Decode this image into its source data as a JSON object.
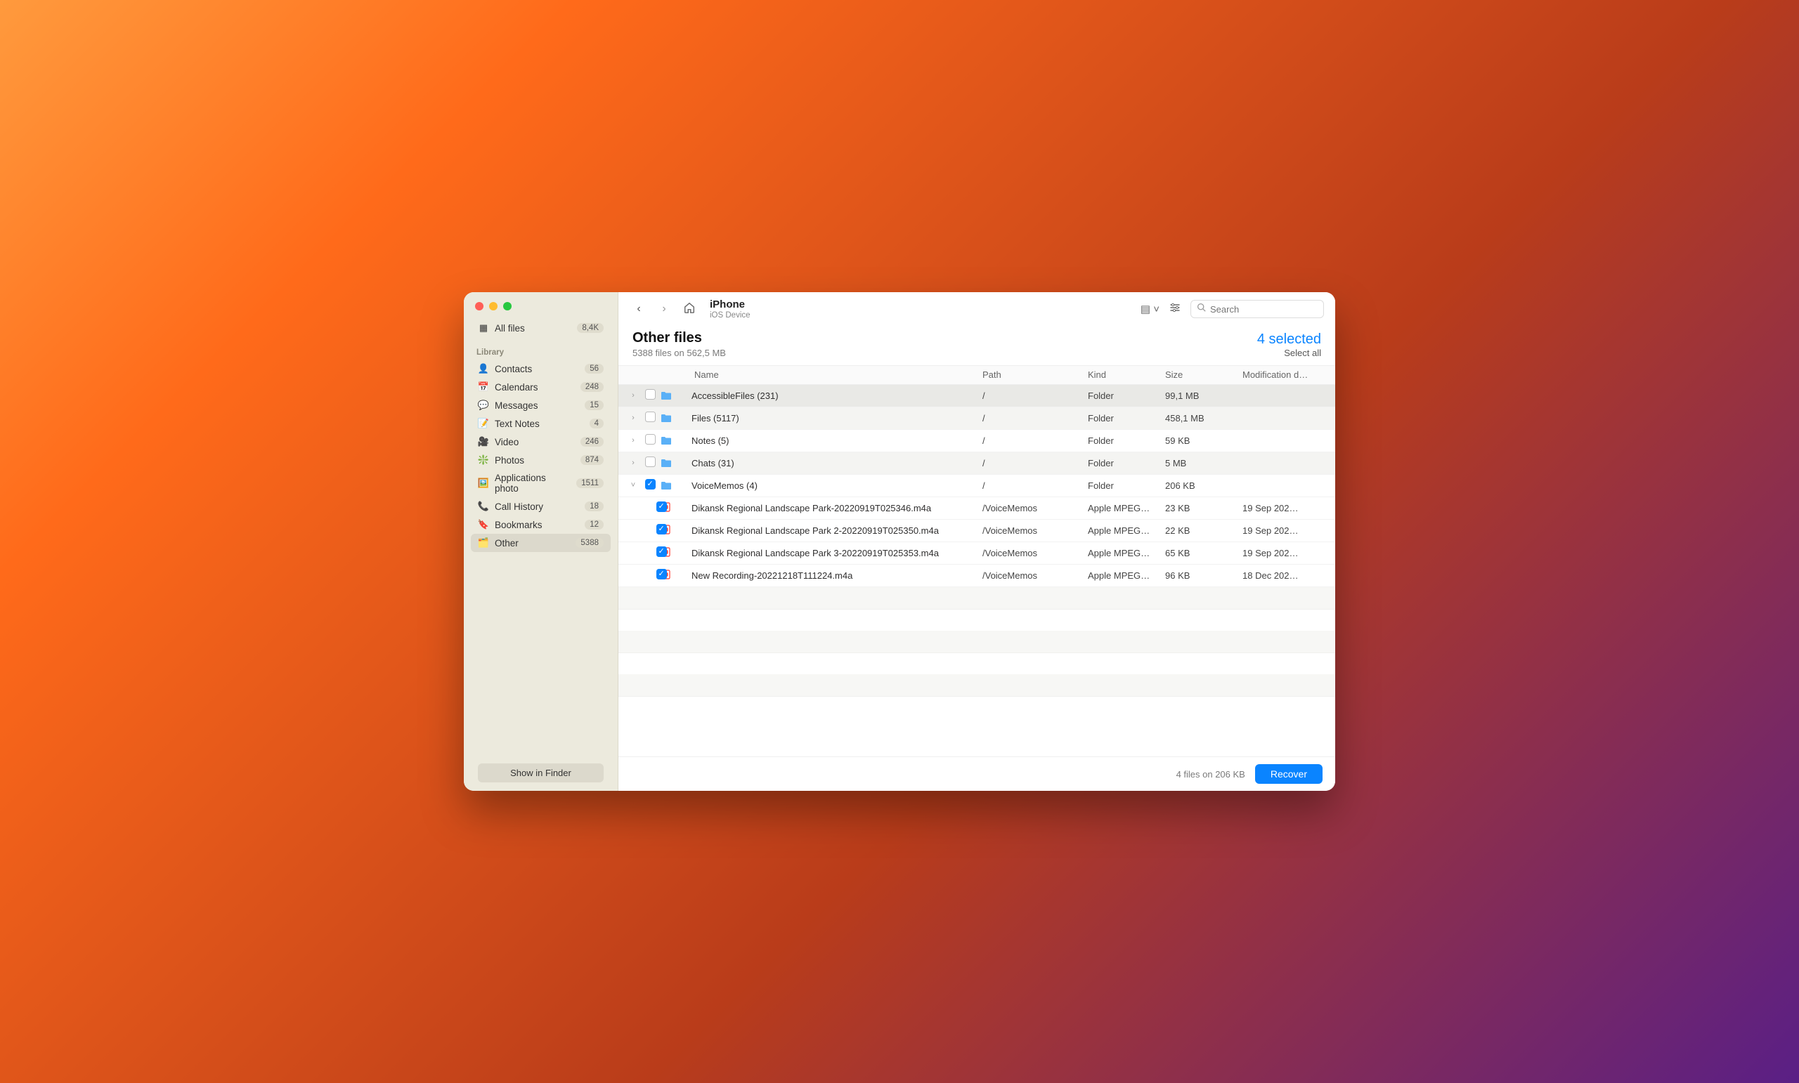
{
  "sidebar": {
    "allfiles_label": "All files",
    "allfiles_count": "8,4K",
    "library_header": "Library",
    "items": [
      {
        "icon": "👤",
        "label": "Contacts",
        "count": "56"
      },
      {
        "icon": "📅",
        "label": "Calendars",
        "count": "248"
      },
      {
        "icon": "💬",
        "label": "Messages",
        "count": "15"
      },
      {
        "icon": "📝",
        "label": "Text Notes",
        "count": "4"
      },
      {
        "icon": "🎥",
        "label": "Video",
        "count": "246"
      },
      {
        "icon": "❇️",
        "label": "Photos",
        "count": "874"
      },
      {
        "icon": "🖼️",
        "label": "Applications photo",
        "count": "1511"
      },
      {
        "icon": "📞",
        "label": "Call History",
        "count": "18"
      },
      {
        "icon": "🔖",
        "label": "Bookmarks",
        "count": "12"
      },
      {
        "icon": "🗂️",
        "label": "Other",
        "count": "5388"
      }
    ],
    "show_in_finder": "Show in Finder"
  },
  "toolbar": {
    "title": "iPhone",
    "subtitle": "iOS Device",
    "search_placeholder": "Search"
  },
  "heading": {
    "title": "Other files",
    "subtitle": "5388 files on 562,5 MB",
    "selected": "4 selected",
    "select_all": "Select all"
  },
  "columns": {
    "name": "Name",
    "path": "Path",
    "kind": "Kind",
    "size": "Size",
    "date": "Modification d…"
  },
  "rows": [
    {
      "type": "folder",
      "expanded": false,
      "checked": false,
      "name": "AccessibleFiles (231)",
      "path": "/",
      "kind": "Folder",
      "size": "99,1 MB",
      "date": "",
      "highlight": true
    },
    {
      "type": "folder",
      "expanded": false,
      "checked": false,
      "name": "Files (5117)",
      "path": "/",
      "kind": "Folder",
      "size": "458,1 MB",
      "date": ""
    },
    {
      "type": "folder",
      "expanded": false,
      "checked": false,
      "name": "Notes (5)",
      "path": "/",
      "kind": "Folder",
      "size": "59 KB",
      "date": ""
    },
    {
      "type": "folder",
      "expanded": false,
      "checked": false,
      "name": "Chats (31)",
      "path": "/",
      "kind": "Folder",
      "size": "5 MB",
      "date": ""
    },
    {
      "type": "folder",
      "expanded": true,
      "checked": true,
      "name": "VoiceMemos (4)",
      "path": "/",
      "kind": "Folder",
      "size": "206 KB",
      "date": ""
    },
    {
      "type": "file",
      "checked": true,
      "name": "Dikansk Regional Landscape Park-20220919T025346.m4a",
      "path": "/VoiceMemos",
      "kind": "Apple MPEG…",
      "size": "23 KB",
      "date": "19 Sep 202…"
    },
    {
      "type": "file",
      "checked": true,
      "name": "Dikansk Regional Landscape Park 2-20220919T025350.m4a",
      "path": "/VoiceMemos",
      "kind": "Apple MPEG…",
      "size": "22 KB",
      "date": "19 Sep 202…"
    },
    {
      "type": "file",
      "checked": true,
      "name": "Dikansk Regional Landscape Park 3-20220919T025353.m4a",
      "path": "/VoiceMemos",
      "kind": "Apple MPEG…",
      "size": "65 KB",
      "date": "19 Sep 202…"
    },
    {
      "type": "file",
      "checked": true,
      "name": "New Recording-20221218T111224.m4a",
      "path": "/VoiceMemos",
      "kind": "Apple MPEG…",
      "size": "96 KB",
      "date": "18 Dec 202…"
    }
  ],
  "footer": {
    "status": "4 files on 206 KB",
    "recover": "Recover"
  }
}
